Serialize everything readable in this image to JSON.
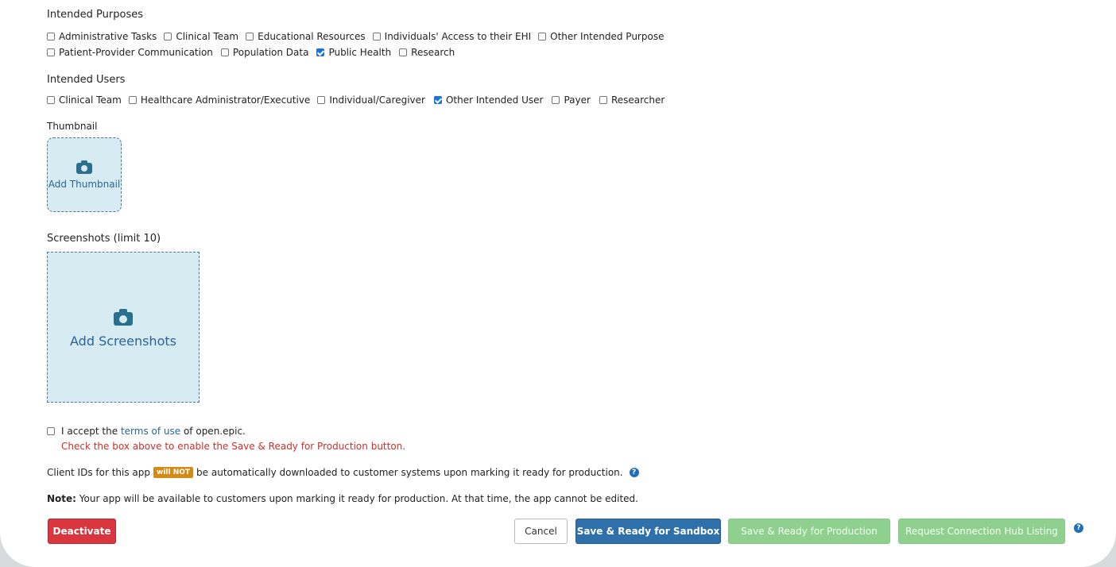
{
  "purposes": {
    "title": "Intended Purposes",
    "row1": [
      {
        "label": "Administrative Tasks",
        "checked": false
      },
      {
        "label": "Clinical Team",
        "checked": false
      },
      {
        "label": "Educational Resources",
        "checked": false
      },
      {
        "label": "Individuals' Access to their EHI",
        "checked": false
      },
      {
        "label": "Other Intended Purpose",
        "checked": false
      }
    ],
    "row2": [
      {
        "label": "Patient-Provider Communication",
        "checked": false
      },
      {
        "label": "Population Data",
        "checked": false
      },
      {
        "label": "Public Health",
        "checked": true
      },
      {
        "label": "Research",
        "checked": false
      }
    ]
  },
  "users": {
    "title": "Intended Users",
    "items": [
      {
        "label": "Clinical Team",
        "checked": false
      },
      {
        "label": "Healthcare Administrator/Executive",
        "checked": false
      },
      {
        "label": "Individual/Caregiver",
        "checked": false
      },
      {
        "label": "Other Intended User",
        "checked": true
      },
      {
        "label": "Payer",
        "checked": false
      },
      {
        "label": "Researcher",
        "checked": false
      }
    ]
  },
  "thumbnail": {
    "title": "Thumbnail",
    "add_label": "Add Thumbnail"
  },
  "screenshots": {
    "title": "Screenshots (limit 10)",
    "add_label": "Add Screenshots"
  },
  "terms": {
    "prefix": "I accept the",
    "link_text": "terms of use",
    "suffix": "of open.epic.",
    "warning": "Check the box above to enable the Save & Ready for Production button.",
    "checked": false
  },
  "client_ids": {
    "prefix": "Client IDs for this app",
    "badge": "will NOT",
    "suffix": "be automatically downloaded to customer systems upon marking it ready for production."
  },
  "note": {
    "label": "Note:",
    "text": "Your app will be available to customers upon marking it ready for production. At that time, the app cannot be edited."
  },
  "buttons": {
    "deactivate": "Deactivate",
    "cancel": "Cancel",
    "save_sandbox": "Save & Ready for Sandbox",
    "save_production": "Save & Ready for Production",
    "request_listing": "Request Connection Hub Listing"
  },
  "icons": {
    "camera": "camera-icon",
    "help": "question-circle-icon",
    "help_glyph": "?"
  },
  "colors": {
    "primary": "#2f6faa",
    "danger": "#d9363e",
    "disabled_green": "#90d08f",
    "warning_badge": "#d68a16",
    "dropzone_bg": "#d6ebf2"
  }
}
